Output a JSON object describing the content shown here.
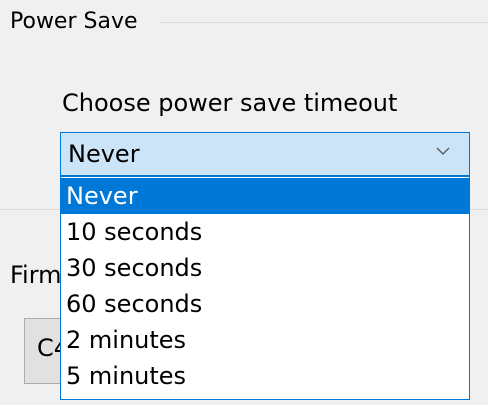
{
  "power_save": {
    "group_title": "Power Save",
    "prompt": "Choose power save timeout",
    "selected_value": "Never",
    "dropdown_icon": "chevron-down-icon",
    "options": [
      "Never",
      "10 seconds",
      "30 seconds",
      "60 seconds",
      "2 minutes",
      "5 minutes"
    ],
    "highlighted_option": "Never"
  },
  "background": {
    "firmware_label_partial": "Firm",
    "button_label_partial": "C4"
  },
  "colors": {
    "accent": "#0078d7",
    "combo_bg": "#cce4f7",
    "window_bg": "#f0f0f0"
  }
}
